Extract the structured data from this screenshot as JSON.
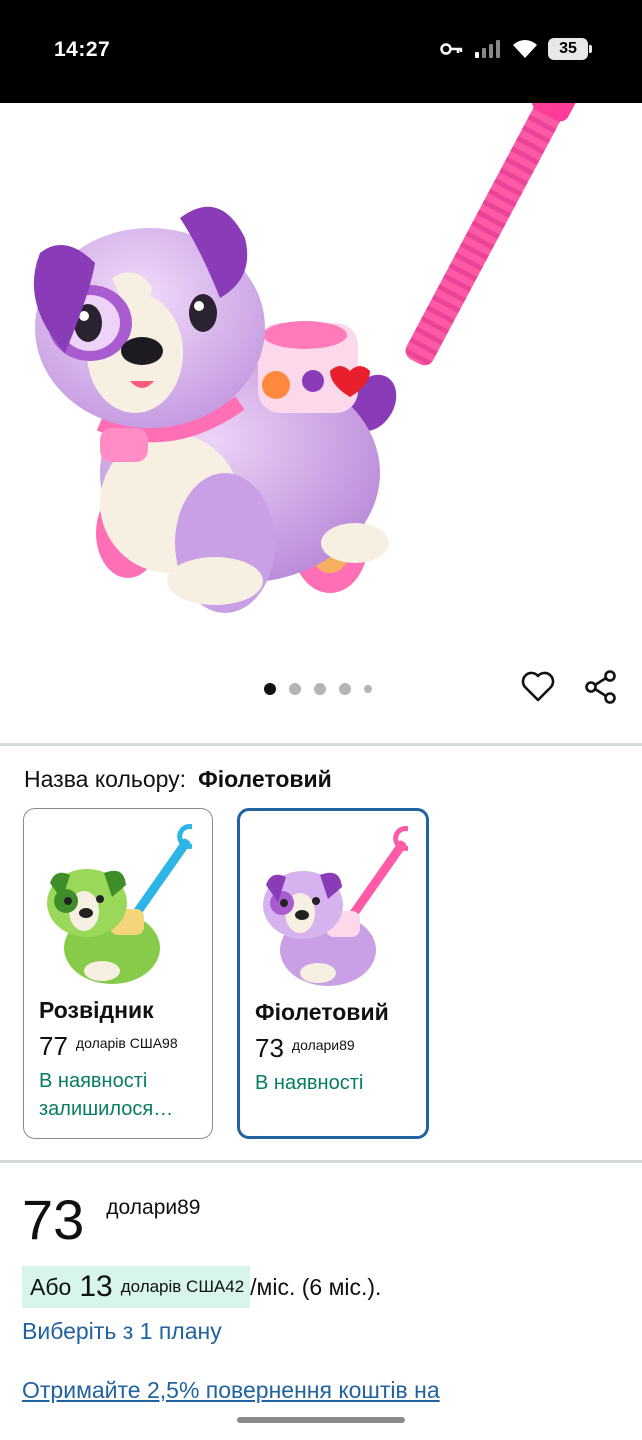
{
  "status_bar": {
    "time": "14:27",
    "battery": "35",
    "icons": [
      "key-icon",
      "signal-icon",
      "wifi-icon",
      "battery-icon"
    ]
  },
  "gallery": {
    "image": "purple-puppy-toy-image",
    "dots_count": 5,
    "active_dot": 0,
    "icons": [
      "heart-icon",
      "share-icon"
    ]
  },
  "color": {
    "label": "Назва кольору:",
    "selected": "Фіолетовий"
  },
  "variants": [
    {
      "name": "Розвідник",
      "price_whole": "77",
      "price_frac": "доларів США98",
      "stock": "В наявності залишилося…",
      "selected": false,
      "accent": "#7ac143"
    },
    {
      "name": "Фіолетовий",
      "price_whole": "73",
      "price_frac": "долари89",
      "stock": "В наявності",
      "selected": true,
      "accent": "#c89ae8"
    }
  ],
  "price": {
    "whole": "73",
    "frac": "долари89"
  },
  "installment": {
    "prefix": "Або",
    "amount": "13",
    "unit": "доларів США42",
    "suffix": "/міс. (6 міс.)."
  },
  "links": {
    "plan": "Виберіть з 1 плану",
    "cashback": "Отримайте 2,5% повернення коштів на"
  },
  "colors": {
    "link": "#2162a1",
    "in_stock": "#067d62",
    "selected_border": "#2162a1",
    "installment_bg": "#d7f5e8"
  }
}
